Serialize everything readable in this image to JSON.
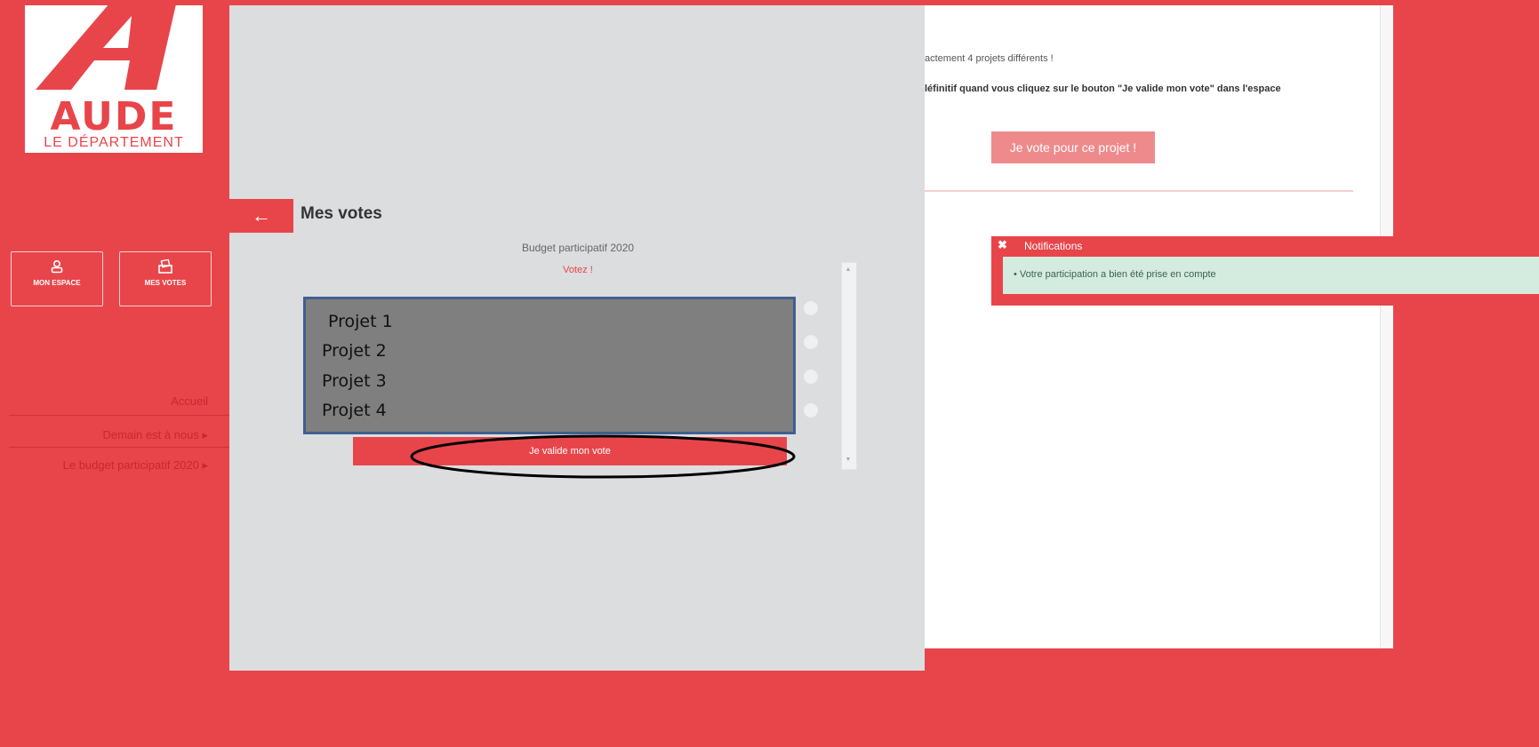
{
  "sidebar": {
    "logo": {
      "word": "AUDE",
      "subtitle": "LE DÉPARTEMENT"
    },
    "buttons": [
      {
        "label": "MON ESPACE",
        "icon": "user-icon"
      },
      {
        "label": "MES VOTES",
        "icon": "ballot-box-icon"
      }
    ],
    "nav": [
      {
        "label": "Accueil"
      },
      {
        "label": "Demain est à nous ▸"
      },
      {
        "label": "Le budget participatif 2020 ▸"
      }
    ]
  },
  "panel": {
    "back_icon": "←",
    "title": "Mes votes",
    "budget_title": "Budget participatif 2020",
    "subtitle": "Votez !",
    "projects": [
      "Projet 1",
      "Projet 2",
      "Projet 3",
      "Projet 4"
    ],
    "validate_label": "Je valide mon vote"
  },
  "content": {
    "text1": "actement 4 projets différents !",
    "text2": "léfinitif quand vous cliquez sur le bouton \"Je valide mon vote\" dans l'espace",
    "vote_button": "Je vote pour ce projet !"
  },
  "notification": {
    "close": "✖",
    "title": "Notifications",
    "message": "•  Votre participation a bien été prise en compte"
  },
  "colors": {
    "brand_red": "#e8454a",
    "panel_gray": "#dcdddf",
    "success_bg": "#d4ecdf"
  }
}
